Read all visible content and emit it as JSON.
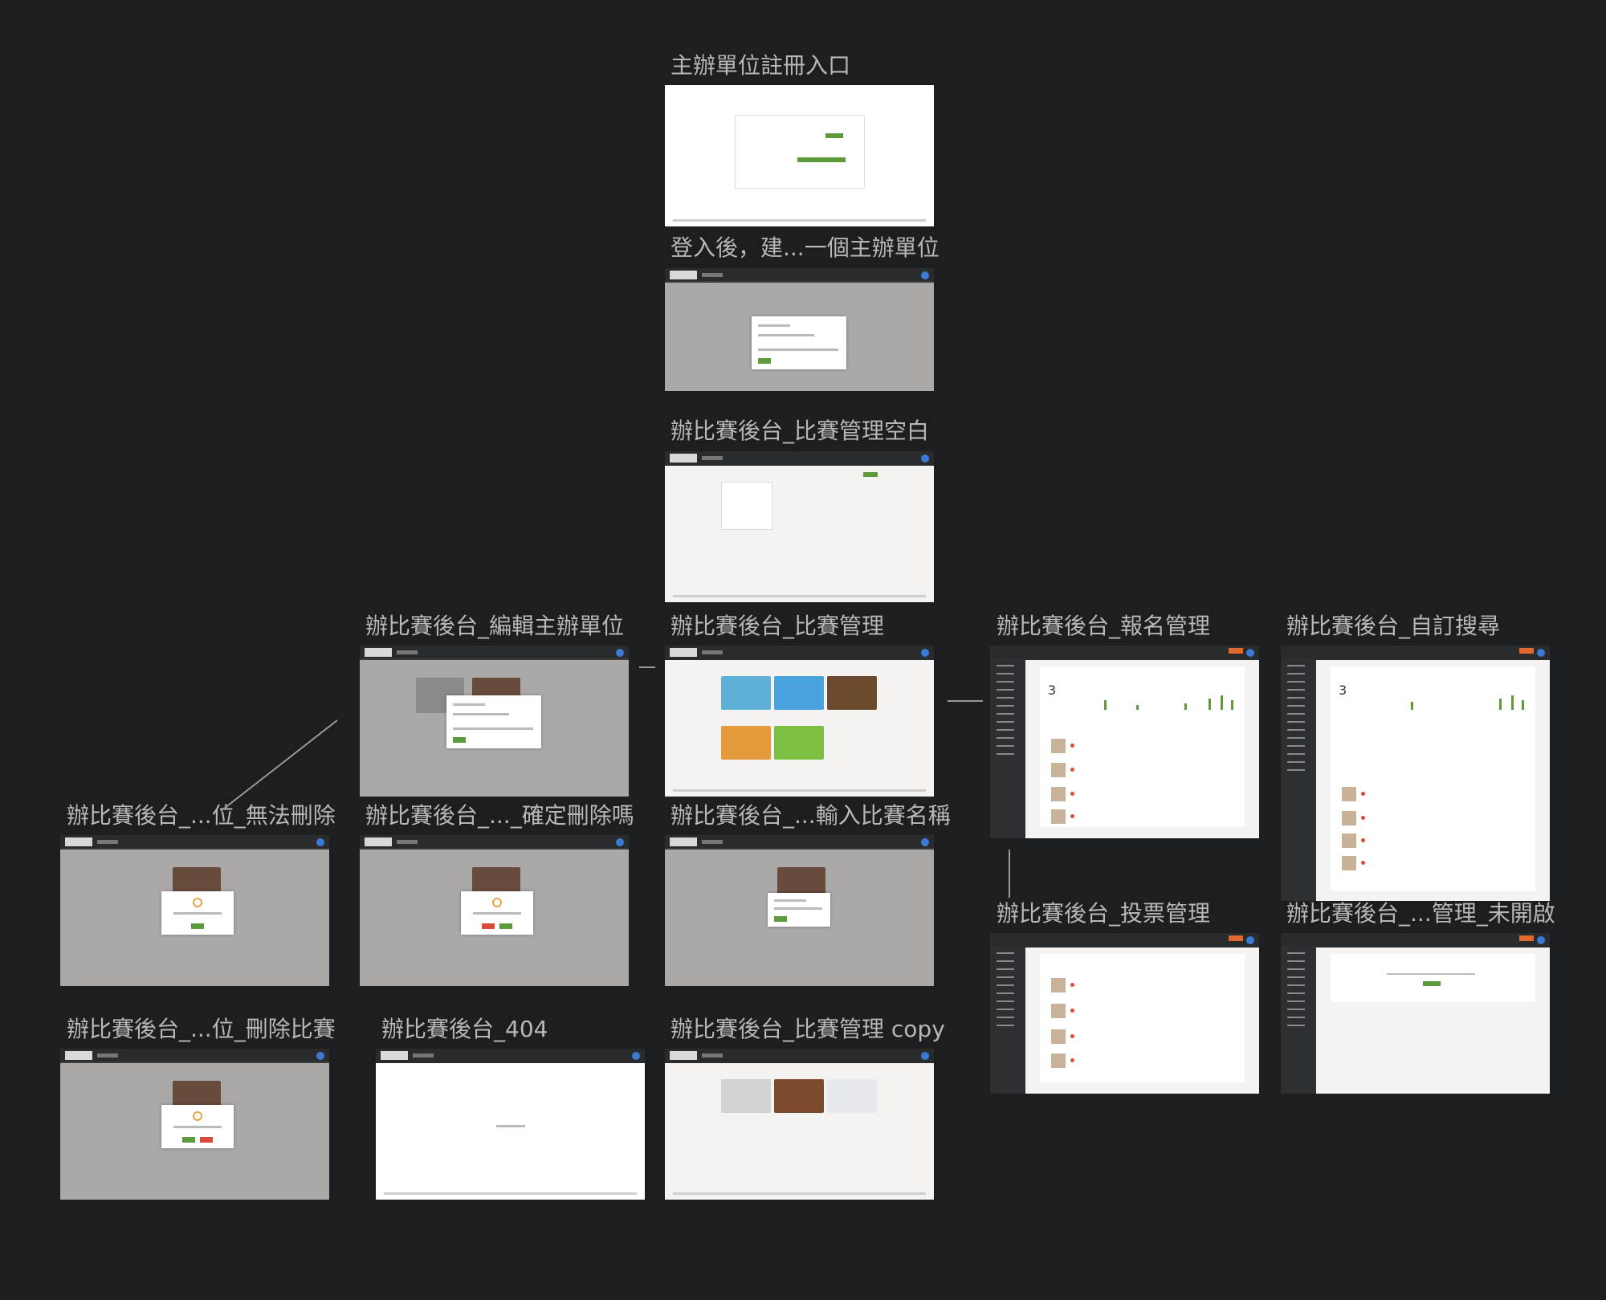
{
  "frames": [
    {
      "id": "f1",
      "label": "主辦單位註冊入口"
    },
    {
      "id": "f2",
      "label": "登入後，建...一個主辦單位"
    },
    {
      "id": "f3",
      "label": "辦比賽後台_比賽管理空白"
    },
    {
      "id": "f4",
      "label": "辦比賽後台_編輯主辦單位"
    },
    {
      "id": "f5",
      "label": "辦比賽後台_比賽管理"
    },
    {
      "id": "f6",
      "label": "辦比賽後台_報名管理"
    },
    {
      "id": "f7",
      "label": "辦比賽後台_自訂搜尋"
    },
    {
      "id": "f8",
      "label": "辦比賽後台_...位_無法刪除"
    },
    {
      "id": "f9",
      "label": "辦比賽後台_..._確定刪除嗎"
    },
    {
      "id": "f10",
      "label": "辦比賽後台_...輸入比賽名稱"
    },
    {
      "id": "f11",
      "label": "辦比賽後台_投票管理"
    },
    {
      "id": "f12",
      "label": "辦比賽後台_...管理_未開啟"
    },
    {
      "id": "f13",
      "label": "辦比賽後台_...位_刪除比賽"
    },
    {
      "id": "f14",
      "label": "辦比賽後台_404"
    },
    {
      "id": "f15",
      "label": "辦比賽後台_比賽管理 copy"
    }
  ],
  "stats": {
    "count_value": "3"
  },
  "colors": {
    "background": "#1d1e20",
    "label": "#b8b8b8",
    "accent_green": "#5c9a3b",
    "accent_orange": "#e0692f",
    "danger_red": "#d94b3b"
  }
}
